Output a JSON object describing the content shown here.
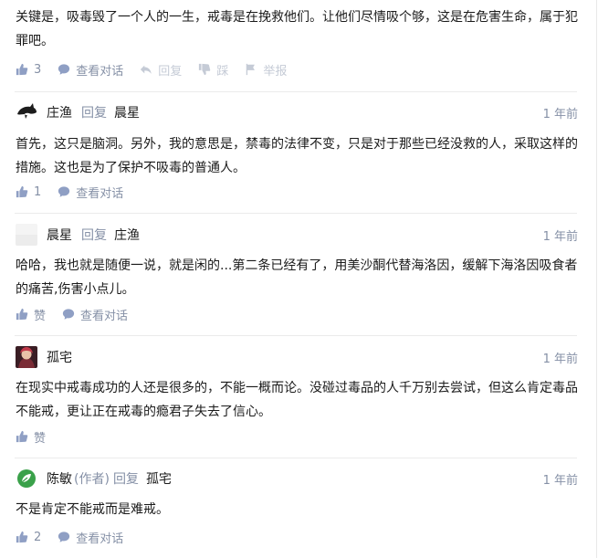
{
  "labels": {
    "reply": "回复",
    "view_conversation": "查看对话",
    "like": "赞",
    "dislike": "踩",
    "report": "举报",
    "author_tag": "(作者)"
  },
  "comments": [
    {
      "text": "关键是，吸毒毁了一个人的一生，戒毒是在挽救他们。让他们尽情吸个够，这是在危害生命，属于犯罪吧。",
      "likes": "3"
    },
    {
      "author": "庄渔",
      "reply_to": "晨星",
      "time": "1 年前",
      "text": "首先，这只是脑洞。另外，我的意思是，禁毒的法律不变，只是对于那些已经没救的人，采取这样的措施。这也是为了保护不吸毒的普通人。",
      "likes": "1"
    },
    {
      "author": "晨星",
      "reply_to": "庄渔",
      "time": "1 年前",
      "text": "哈哈，我也就是随便一说，就是闲的...第二条已经有了，用美沙酮代替海洛因，缓解下海洛因吸食者的痛苦,伤害小点儿。",
      "likes": "赞"
    },
    {
      "author": "孤宅",
      "time": "1 年前",
      "text": "在现实中戒毒成功的人还是很多的，不能一概而论。没碰过毒品的人千万别去尝试，但这么肯定毒品不能戒，更让正在戒毒的瘾君子失去了信心。",
      "likes": "赞"
    },
    {
      "author": "陈敏",
      "reply_to": "孤宅",
      "time": "1 年前",
      "text": "不是肯定不能戒而是难戒。",
      "likes": "2"
    }
  ],
  "colors": {
    "meta": "#8590a6",
    "text": "#1a1a1a",
    "divider": "#ebebeb"
  }
}
